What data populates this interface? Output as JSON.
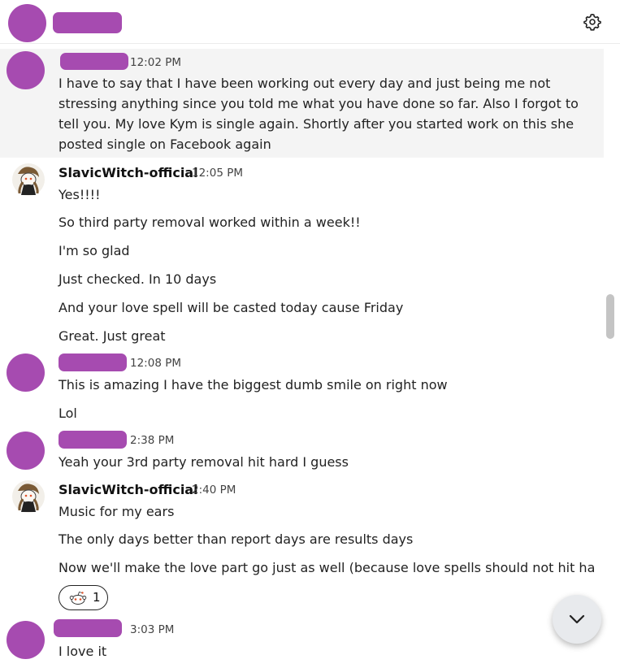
{
  "header": {
    "settings_icon": "gear-icon"
  },
  "messages": [
    {
      "time": "12:02 PM",
      "text": "I have to say that I have been working out every day and just being me not stressing anything since you told me what you have done so far. Also I forgot to tell you. My love Kym is single again. Shortly after you started work on this she posted single on Facebook again"
    },
    {
      "name": "SlavicWitch-official",
      "time": "12:05 PM",
      "lines": [
        "Yes!!!!",
        "So third party removal worked within a week!!",
        "I'm so glad",
        "Just checked. In 10 days",
        "And your love spell will be casted today cause Friday",
        "Great. Just great"
      ]
    },
    {
      "time": "12:08 PM",
      "lines": [
        "This is amazing I have the biggest dumb smile on right now",
        "Lol"
      ]
    },
    {
      "time": "2:38 PM",
      "lines": [
        "Yeah your 3rd party removal hit hard I guess"
      ]
    },
    {
      "name": "SlavicWitch-official",
      "time": "2:40 PM",
      "lines": [
        "Music for my ears",
        "The only days better than report days are results days",
        "Now we'll make the love part go just as well (because love spells should not hit hard"
      ]
    },
    {
      "time": "3:03 PM",
      "lines": [
        "I love it"
      ]
    }
  ],
  "reaction": {
    "icon": "reddit-snoo-icon",
    "count": "1"
  },
  "scroll_down_icon": "chevron-down-icon",
  "colors": {
    "redaction": "#a64bb0",
    "highlight": "#f4f4f4"
  }
}
